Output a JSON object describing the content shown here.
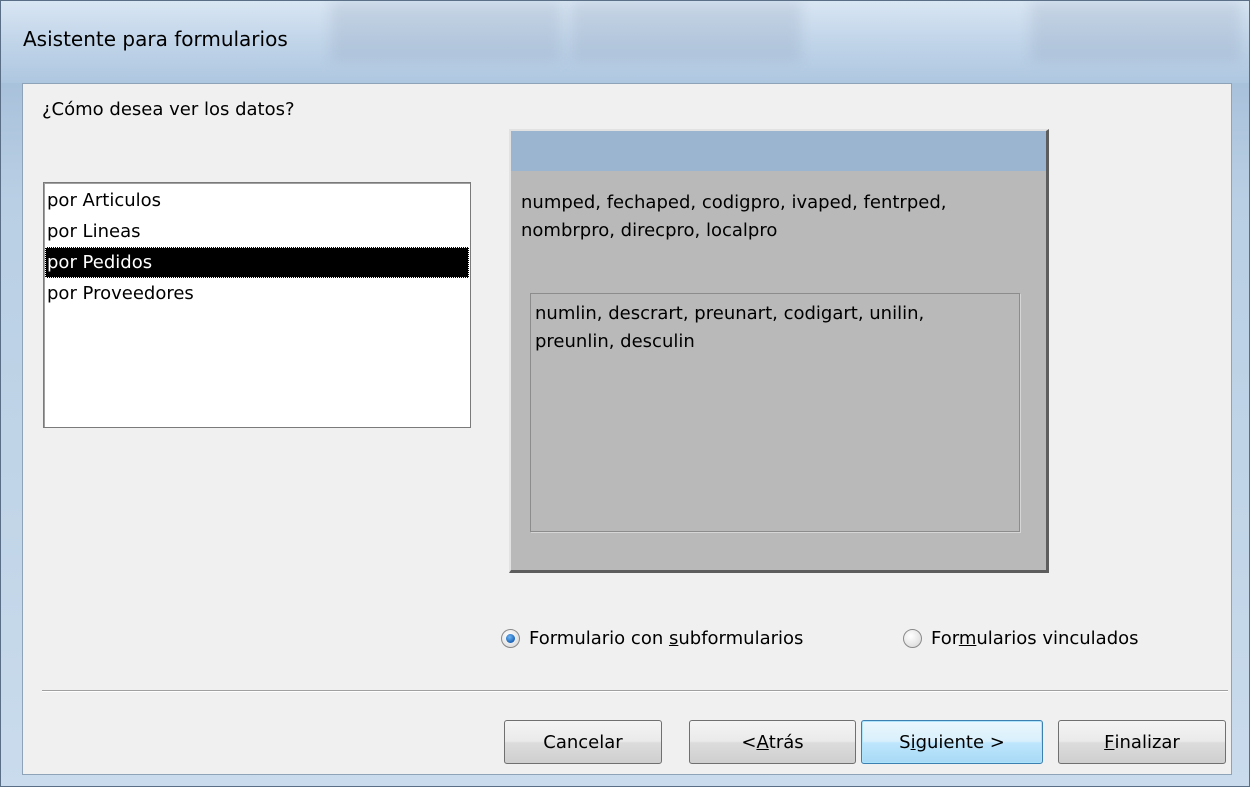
{
  "window": {
    "title": "Asistente para formularios"
  },
  "prompt": "¿Cómo desea ver los datos?",
  "view_options": [
    {
      "label": "por Articulos",
      "selected": false
    },
    {
      "label": "por Lineas",
      "selected": false
    },
    {
      "label": "por Pedidos",
      "selected": true
    },
    {
      "label": "por Proveedores",
      "selected": false
    }
  ],
  "preview": {
    "main_fields": "numped, fechaped, codigpro, ivaped, fentrped, nombrpro, direcpro, localpro",
    "subform_fields": "numlin, descrart, preunart, codigart, unilin, preunlin, desculin"
  },
  "layout_options": {
    "subform": {
      "label_pre": "Formulario con ",
      "label_accel": "s",
      "label_post": "ubformularios",
      "checked": true
    },
    "linked": {
      "label_pre": "For",
      "label_accel": "m",
      "label_post": "ularios vinculados",
      "checked": false
    }
  },
  "buttons": {
    "cancel": {
      "label": "Cancelar"
    },
    "back": {
      "pre": "< ",
      "accel": "A",
      "post": "trás"
    },
    "next": {
      "pre": "S",
      "accel": "i",
      "post": "guiente >"
    },
    "finish": {
      "pre": "",
      "accel": "F",
      "post": "inalizar"
    }
  },
  "colors": {
    "selection_bg": "#000000",
    "preview_bg": "#b9b9b9",
    "preview_header": "#9bb4cf",
    "dialog_bg": "#f0f0f0"
  }
}
